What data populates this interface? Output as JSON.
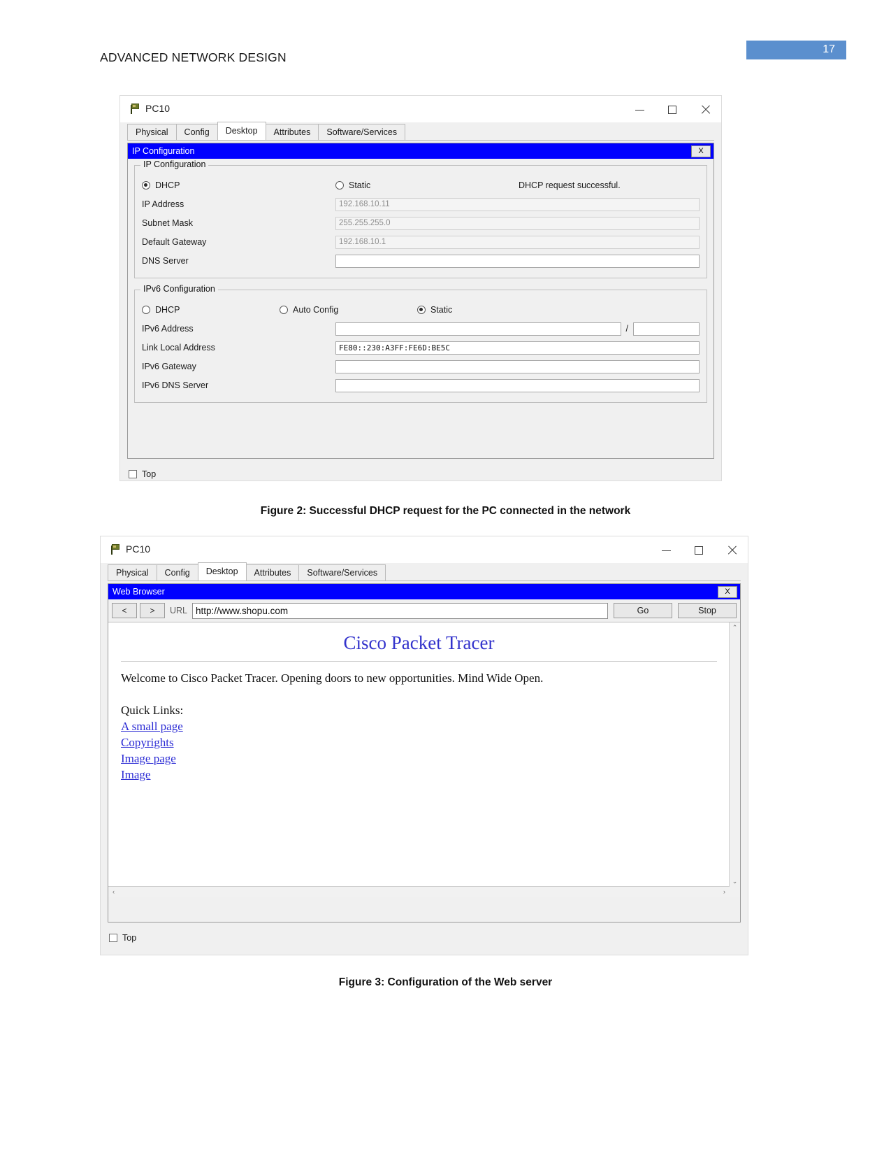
{
  "header": {
    "doc_title": "ADVANCED NETWORK DESIGN",
    "page_number": "17",
    "badge_color": "#5b8fce"
  },
  "figure2": {
    "window": {
      "title": "PC10",
      "icon": "packet-tracer-pc-icon",
      "minimize": "–",
      "maximize": "□",
      "close": "✕"
    },
    "tabs": [
      {
        "label": "Physical",
        "active": false
      },
      {
        "label": "Config",
        "active": false
      },
      {
        "label": "Desktop",
        "active": true
      },
      {
        "label": "Attributes",
        "active": false
      },
      {
        "label": "Software/Services",
        "active": false
      }
    ],
    "app": {
      "title": "IP Configuration",
      "close_label": "X"
    },
    "ipv4": {
      "legend": "IP Configuration",
      "dhcp_label": "DHCP",
      "static_label": "Static",
      "selected": "DHCP",
      "status": "DHCP request successful.",
      "fields": [
        {
          "label": "IP Address",
          "value": "192.168.10.11",
          "readonly": true
        },
        {
          "label": "Subnet Mask",
          "value": "255.255.255.0",
          "readonly": true
        },
        {
          "label": "Default Gateway",
          "value": "192.168.10.1",
          "readonly": true
        },
        {
          "label": "DNS Server",
          "value": "",
          "readonly": true
        }
      ]
    },
    "ipv6": {
      "legend": "IPv6 Configuration",
      "dhcp_label": "DHCP",
      "autoconfig_label": "Auto Config",
      "static_label": "Static",
      "selected": "Static",
      "address_label": "IPv6 Address",
      "address_value": "",
      "prefix_value": "",
      "prefix_separator": "/",
      "fields": [
        {
          "label": "Link Local Address",
          "value": "FE80::230:A3FF:FE6D:BE5C"
        },
        {
          "label": "IPv6 Gateway",
          "value": ""
        },
        {
          "label": "IPv6 DNS Server",
          "value": ""
        }
      ]
    },
    "bottom": {
      "top_checkbox_label": "Top",
      "top_checked": false
    },
    "caption": "Figure 2: Successful DHCP request for the PC connected in the network"
  },
  "figure3": {
    "window": {
      "title": "PC10",
      "icon": "packet-tracer-pc-icon",
      "minimize": "–",
      "maximize": "□",
      "close": "✕"
    },
    "tabs": [
      {
        "label": "Physical",
        "active": false
      },
      {
        "label": "Config",
        "active": false
      },
      {
        "label": "Desktop",
        "active": true
      },
      {
        "label": "Attributes",
        "active": false
      },
      {
        "label": "Software/Services",
        "active": false
      }
    ],
    "app": {
      "title": "Web Browser",
      "close_label": "X"
    },
    "toolbar": {
      "back_label": "<",
      "forward_label": ">",
      "url_label": "URL",
      "url_value": "http://www.shopu.com",
      "go_label": "Go",
      "stop_label": "Stop"
    },
    "webpage": {
      "heading": "Cisco Packet Tracer",
      "paragraph": "Welcome to Cisco Packet Tracer. Opening doors to new opportunities. Mind Wide Open.",
      "quick_links_label": "Quick Links:",
      "links": [
        "A small page",
        "Copyrights",
        "Image page",
        "Image"
      ],
      "heading_color": "#3333cc",
      "link_color": "#2a2ad4"
    },
    "scrollbar": {
      "up": "⌃",
      "down": "⌄",
      "left": "‹",
      "right": "›"
    },
    "bottom": {
      "top_checkbox_label": "Top",
      "top_checked": false
    },
    "caption": "Figure 3: Configuration of the Web server"
  }
}
